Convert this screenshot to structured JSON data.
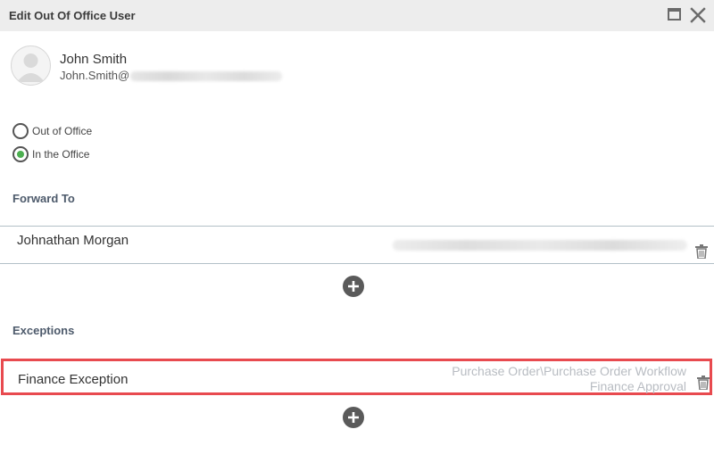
{
  "dialog": {
    "title": "Edit Out Of Office User"
  },
  "user": {
    "name": "John Smith",
    "email": "John.Smith@"
  },
  "status": {
    "options": [
      {
        "label": "Out of Office",
        "selected": false
      },
      {
        "label": "In the Office",
        "selected": true
      }
    ]
  },
  "forward": {
    "section_title": "Forward To",
    "entry_name": "Johnathan Morgan"
  },
  "exceptions": {
    "section_title": "Exceptions",
    "entry_name": "Finance Exception",
    "workflow_path": "Purchase Order\\Purchase Order Workflow",
    "workflow_step": "Finance Approval"
  },
  "colors": {
    "selected_radio": "#4caf50",
    "highlight_border": "#e84a4f",
    "titlebar_bg": "#ededed"
  },
  "icons": [
    "maximize-icon",
    "close-icon",
    "avatar-icon",
    "trash-icon",
    "plus-circle-icon"
  ]
}
